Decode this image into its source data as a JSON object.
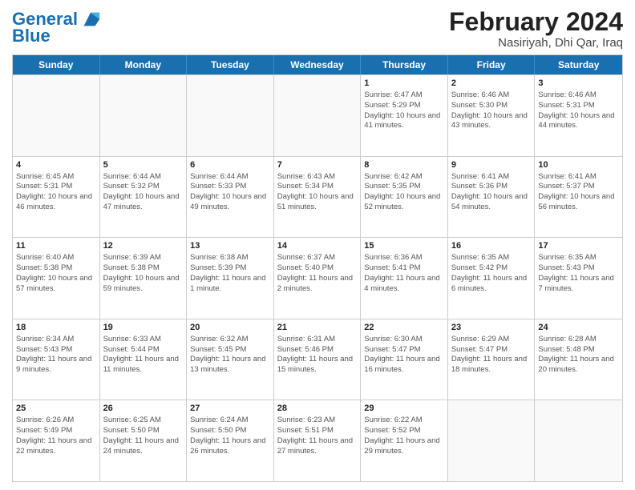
{
  "header": {
    "logo_line1": "General",
    "logo_line2": "Blue",
    "month_year": "February 2024",
    "location": "Nasiriyah, Dhi Qar, Iraq"
  },
  "days_of_week": [
    "Sunday",
    "Monday",
    "Tuesday",
    "Wednesday",
    "Thursday",
    "Friday",
    "Saturday"
  ],
  "weeks": [
    [
      {
        "day": "",
        "sunrise": "",
        "sunset": "",
        "daylight": ""
      },
      {
        "day": "",
        "sunrise": "",
        "sunset": "",
        "daylight": ""
      },
      {
        "day": "",
        "sunrise": "",
        "sunset": "",
        "daylight": ""
      },
      {
        "day": "",
        "sunrise": "",
        "sunset": "",
        "daylight": ""
      },
      {
        "day": "1",
        "sunrise": "Sunrise: 6:47 AM",
        "sunset": "Sunset: 5:29 PM",
        "daylight": "Daylight: 10 hours and 41 minutes."
      },
      {
        "day": "2",
        "sunrise": "Sunrise: 6:46 AM",
        "sunset": "Sunset: 5:30 PM",
        "daylight": "Daylight: 10 hours and 43 minutes."
      },
      {
        "day": "3",
        "sunrise": "Sunrise: 6:46 AM",
        "sunset": "Sunset: 5:31 PM",
        "daylight": "Daylight: 10 hours and 44 minutes."
      }
    ],
    [
      {
        "day": "4",
        "sunrise": "Sunrise: 6:45 AM",
        "sunset": "Sunset: 5:31 PM",
        "daylight": "Daylight: 10 hours and 46 minutes."
      },
      {
        "day": "5",
        "sunrise": "Sunrise: 6:44 AM",
        "sunset": "Sunset: 5:32 PM",
        "daylight": "Daylight: 10 hours and 47 minutes."
      },
      {
        "day": "6",
        "sunrise": "Sunrise: 6:44 AM",
        "sunset": "Sunset: 5:33 PM",
        "daylight": "Daylight: 10 hours and 49 minutes."
      },
      {
        "day": "7",
        "sunrise": "Sunrise: 6:43 AM",
        "sunset": "Sunset: 5:34 PM",
        "daylight": "Daylight: 10 hours and 51 minutes."
      },
      {
        "day": "8",
        "sunrise": "Sunrise: 6:42 AM",
        "sunset": "Sunset: 5:35 PM",
        "daylight": "Daylight: 10 hours and 52 minutes."
      },
      {
        "day": "9",
        "sunrise": "Sunrise: 6:41 AM",
        "sunset": "Sunset: 5:36 PM",
        "daylight": "Daylight: 10 hours and 54 minutes."
      },
      {
        "day": "10",
        "sunrise": "Sunrise: 6:41 AM",
        "sunset": "Sunset: 5:37 PM",
        "daylight": "Daylight: 10 hours and 56 minutes."
      }
    ],
    [
      {
        "day": "11",
        "sunrise": "Sunrise: 6:40 AM",
        "sunset": "Sunset: 5:38 PM",
        "daylight": "Daylight: 10 hours and 57 minutes."
      },
      {
        "day": "12",
        "sunrise": "Sunrise: 6:39 AM",
        "sunset": "Sunset: 5:38 PM",
        "daylight": "Daylight: 10 hours and 59 minutes."
      },
      {
        "day": "13",
        "sunrise": "Sunrise: 6:38 AM",
        "sunset": "Sunset: 5:39 PM",
        "daylight": "Daylight: 11 hours and 1 minute."
      },
      {
        "day": "14",
        "sunrise": "Sunrise: 6:37 AM",
        "sunset": "Sunset: 5:40 PM",
        "daylight": "Daylight: 11 hours and 2 minutes."
      },
      {
        "day": "15",
        "sunrise": "Sunrise: 6:36 AM",
        "sunset": "Sunset: 5:41 PM",
        "daylight": "Daylight: 11 hours and 4 minutes."
      },
      {
        "day": "16",
        "sunrise": "Sunrise: 6:35 AM",
        "sunset": "Sunset: 5:42 PM",
        "daylight": "Daylight: 11 hours and 6 minutes."
      },
      {
        "day": "17",
        "sunrise": "Sunrise: 6:35 AM",
        "sunset": "Sunset: 5:43 PM",
        "daylight": "Daylight: 11 hours and 7 minutes."
      }
    ],
    [
      {
        "day": "18",
        "sunrise": "Sunrise: 6:34 AM",
        "sunset": "Sunset: 5:43 PM",
        "daylight": "Daylight: 11 hours and 9 minutes."
      },
      {
        "day": "19",
        "sunrise": "Sunrise: 6:33 AM",
        "sunset": "Sunset: 5:44 PM",
        "daylight": "Daylight: 11 hours and 11 minutes."
      },
      {
        "day": "20",
        "sunrise": "Sunrise: 6:32 AM",
        "sunset": "Sunset: 5:45 PM",
        "daylight": "Daylight: 11 hours and 13 minutes."
      },
      {
        "day": "21",
        "sunrise": "Sunrise: 6:31 AM",
        "sunset": "Sunset: 5:46 PM",
        "daylight": "Daylight: 11 hours and 15 minutes."
      },
      {
        "day": "22",
        "sunrise": "Sunrise: 6:30 AM",
        "sunset": "Sunset: 5:47 PM",
        "daylight": "Daylight: 11 hours and 16 minutes."
      },
      {
        "day": "23",
        "sunrise": "Sunrise: 6:29 AM",
        "sunset": "Sunset: 5:47 PM",
        "daylight": "Daylight: 11 hours and 18 minutes."
      },
      {
        "day": "24",
        "sunrise": "Sunrise: 6:28 AM",
        "sunset": "Sunset: 5:48 PM",
        "daylight": "Daylight: 11 hours and 20 minutes."
      }
    ],
    [
      {
        "day": "25",
        "sunrise": "Sunrise: 6:26 AM",
        "sunset": "Sunset: 5:49 PM",
        "daylight": "Daylight: 11 hours and 22 minutes."
      },
      {
        "day": "26",
        "sunrise": "Sunrise: 6:25 AM",
        "sunset": "Sunset: 5:50 PM",
        "daylight": "Daylight: 11 hours and 24 minutes."
      },
      {
        "day": "27",
        "sunrise": "Sunrise: 6:24 AM",
        "sunset": "Sunset: 5:50 PM",
        "daylight": "Daylight: 11 hours and 26 minutes."
      },
      {
        "day": "28",
        "sunrise": "Sunrise: 6:23 AM",
        "sunset": "Sunset: 5:51 PM",
        "daylight": "Daylight: 11 hours and 27 minutes."
      },
      {
        "day": "29",
        "sunrise": "Sunrise: 6:22 AM",
        "sunset": "Sunset: 5:52 PM",
        "daylight": "Daylight: 11 hours and 29 minutes."
      },
      {
        "day": "",
        "sunrise": "",
        "sunset": "",
        "daylight": ""
      },
      {
        "day": "",
        "sunrise": "",
        "sunset": "",
        "daylight": ""
      }
    ]
  ]
}
